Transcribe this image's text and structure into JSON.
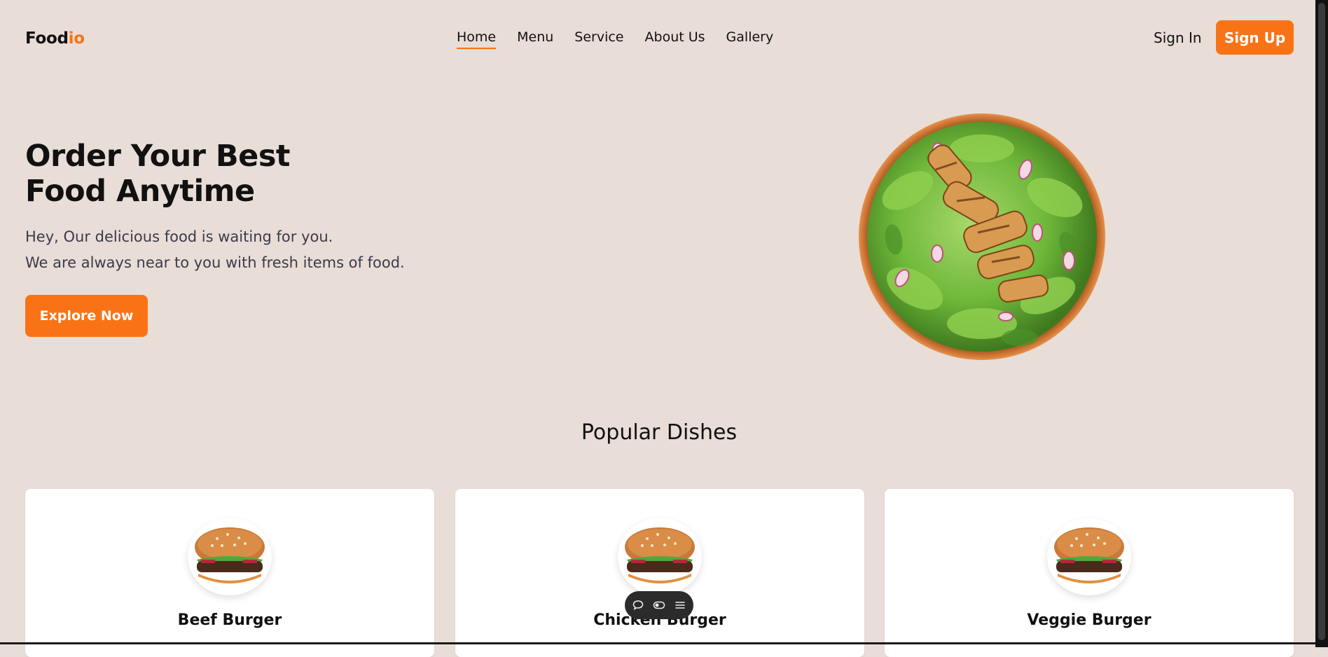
{
  "header": {
    "logo": {
      "prefix": "Food",
      "accent": "io"
    },
    "nav": [
      "Home",
      "Menu",
      "Service",
      "About Us",
      "Gallery"
    ],
    "active_nav": "Home",
    "sign_in": "Sign In",
    "sign_up": "Sign Up"
  },
  "hero": {
    "title_line1": "Order Your Best",
    "title_line2": "Food Anytime",
    "subtitle_line1": "Hey, Our delicious food is waiting for you.",
    "subtitle_line2": "We are always near to you with fresh items of food.",
    "cta": "Explore Now",
    "image": "grilled-chicken-salad-bowl"
  },
  "popular": {
    "title": "Popular Dishes",
    "dishes": [
      {
        "name": "Beef Burger",
        "image": "burger"
      },
      {
        "name": "Chicken Burger",
        "image": "burger"
      },
      {
        "name": "Veggie Burger",
        "image": "burger"
      }
    ]
  },
  "floating_toolbar": {
    "icons": [
      "chat-bubble-icon",
      "toggle-icon",
      "menu-icon"
    ]
  },
  "colors": {
    "background": "#e8ddd7",
    "accent": "#f97316",
    "card": "#ffffff",
    "text": "#111111"
  }
}
